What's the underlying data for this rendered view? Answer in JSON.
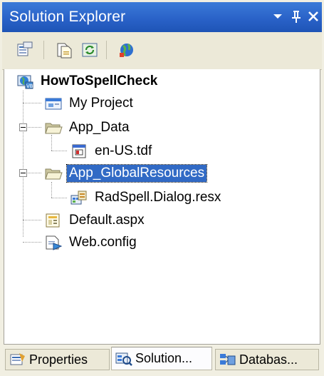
{
  "window": {
    "title": "Solution Explorer",
    "title_buttons": [
      "dropdown-icon",
      "pin-icon",
      "close-icon"
    ]
  },
  "toolbar": {
    "buttons": [
      "properties-icon",
      "show-all-files-icon",
      "refresh-icon",
      "copy-website-icon"
    ]
  },
  "tree": {
    "root": {
      "label": "HowToSpellCheck",
      "icon": "web-project-icon"
    },
    "items": [
      {
        "label": "My Project",
        "icon": "my-project-icon"
      },
      {
        "label": "App_Data",
        "icon": "folder-icon",
        "expanded": true,
        "children": [
          {
            "label": "en-US.tdf",
            "icon": "tdf-file-icon"
          }
        ]
      },
      {
        "label": "App_GlobalResources",
        "icon": "folder-icon",
        "expanded": true,
        "selected": true,
        "children": [
          {
            "label": "RadSpell.Dialog.resx",
            "icon": "resx-file-icon"
          }
        ]
      },
      {
        "label": "Default.aspx",
        "icon": "aspx-file-icon"
      },
      {
        "label": "Web.config",
        "icon": "config-file-icon"
      }
    ]
  },
  "tabs": [
    {
      "label": "Properties",
      "icon": "properties-tab-icon",
      "active": false
    },
    {
      "label": "Solution...",
      "icon": "solution-explorer-tab-icon",
      "active": true
    },
    {
      "label": "Databas...",
      "icon": "database-explorer-tab-icon",
      "active": false
    }
  ],
  "colors": {
    "titlebar": "#2a62c8",
    "selection": "#316ac5",
    "background": "#f1efe2"
  }
}
